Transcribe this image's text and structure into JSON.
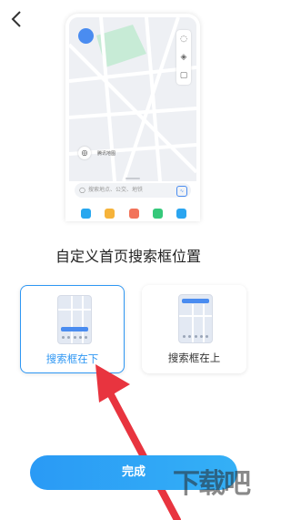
{
  "header": {
    "back_icon": "chevron-left-icon"
  },
  "preview": {
    "search_placeholder": "搜索地点、公交、地铁",
    "brand_text": "腾讯地图",
    "shortcut_colors": [
      "#28a7ef",
      "#f6b33a",
      "#f2735a",
      "#35c87a",
      "#2aa5f0"
    ]
  },
  "title": "自定义首页搜索框位置",
  "options": [
    {
      "label": "搜索框在下",
      "selected": true
    },
    {
      "label": "搜索框在上",
      "selected": false
    }
  ],
  "done_label": "完成",
  "watermark": "下载吧",
  "colors": {
    "accent": "#2f97f3",
    "arrow": "#e8343f"
  }
}
